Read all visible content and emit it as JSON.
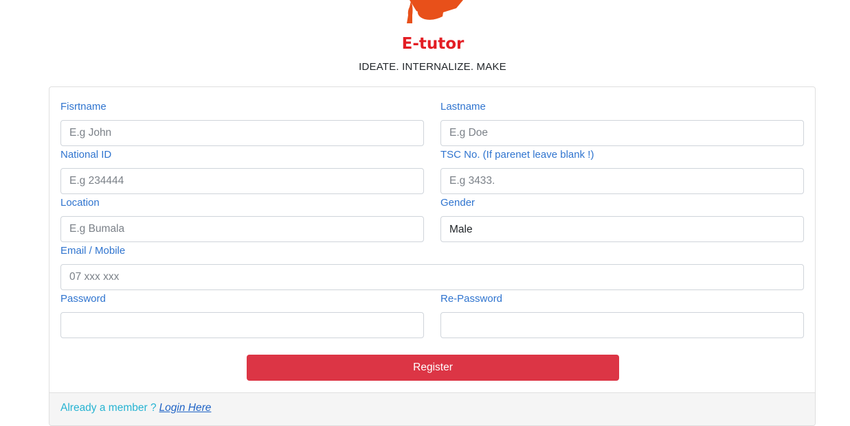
{
  "brand": {
    "logo_text": "E-tutor",
    "tagline": "IDEATE. INTERNALIZE. MAKE",
    "logo_color": "#e31e24",
    "cap_color": "#e8501a"
  },
  "form": {
    "firstname": {
      "label": "Fisrtname",
      "placeholder": "E.g John",
      "value": ""
    },
    "lastname": {
      "label": "Lastname",
      "placeholder": "E.g Doe",
      "value": ""
    },
    "national_id": {
      "label": "National ID",
      "placeholder": "E.g 234444",
      "value": ""
    },
    "tsc_no": {
      "label": "TSC No. (If parenet leave blank !)",
      "placeholder": "E.g 3433.",
      "value": ""
    },
    "location": {
      "label": "Location",
      "placeholder": "E.g Bumala",
      "value": ""
    },
    "gender": {
      "label": "Gender",
      "selected": "Male"
    },
    "email_mobile": {
      "label": "Email / Mobile",
      "placeholder": "07 xxx xxx",
      "value": ""
    },
    "password": {
      "label": "Password",
      "value": ""
    },
    "re_password": {
      "label": "Re-Password",
      "value": ""
    },
    "submit_label": "Register",
    "submit_color": "#dc3545",
    "label_color": "#2f74cf"
  },
  "footer": {
    "prompt": "Already a member ?",
    "login_link": "Login Here",
    "prompt_color": "#25b3d2",
    "link_color": "#1f63c6"
  }
}
